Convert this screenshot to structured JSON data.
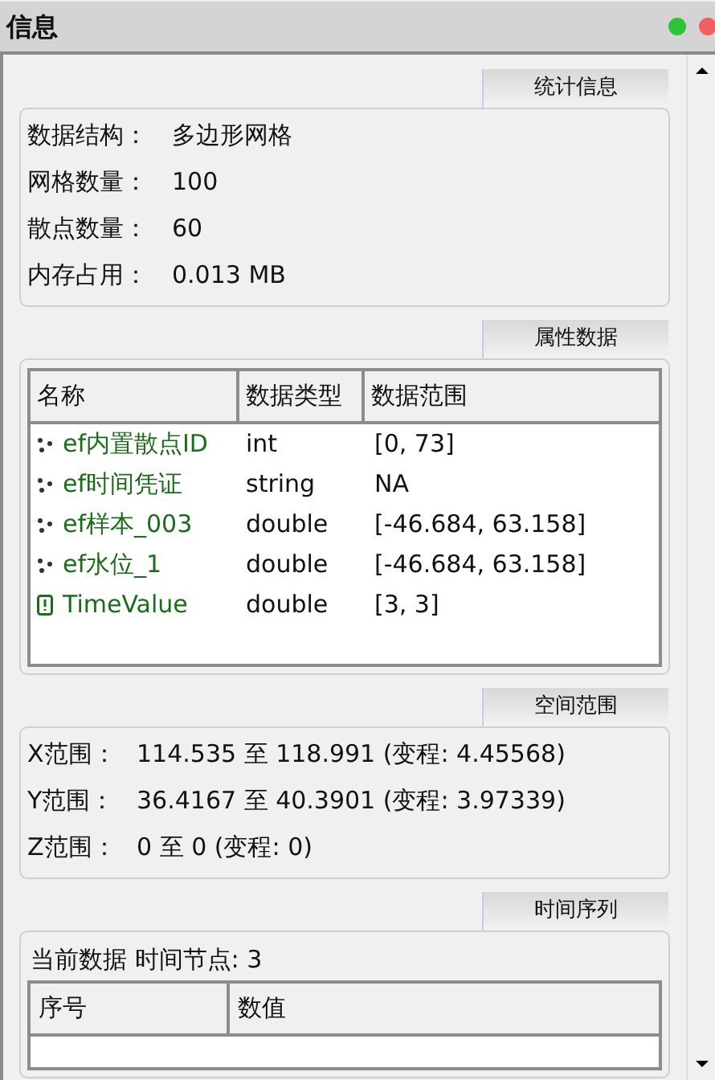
{
  "window": {
    "title": "信息"
  },
  "stats": {
    "tab": "统计信息",
    "rows": [
      {
        "label": "数据结构：",
        "value": "多边形网格"
      },
      {
        "label": "网格数量：",
        "value": "100"
      },
      {
        "label": "散点数量：",
        "value": "60"
      },
      {
        "label": "内存占用：",
        "value": "0.013 MB"
      }
    ]
  },
  "attributes": {
    "tab": "属性数据",
    "columns": [
      "名称",
      "数据类型",
      "数据范围"
    ],
    "rows": [
      {
        "kind": "scatter",
        "name": "ef内置散点ID",
        "type": "int",
        "range": "[0, 73]"
      },
      {
        "kind": "scatter",
        "name": "ef时间凭证",
        "type": "string",
        "range": "NA"
      },
      {
        "kind": "scatter",
        "name": "ef样本_003",
        "type": "double",
        "range": "[-46.684, 63.158]"
      },
      {
        "kind": "scatter",
        "name": "ef水位_1",
        "type": "double",
        "range": "[-46.684, 63.158]"
      },
      {
        "kind": "time",
        "name": "TimeValue",
        "type": "double",
        "range": "[3, 3]"
      }
    ]
  },
  "extent": {
    "tab": "空间范围",
    "rows": [
      {
        "label": "X范围：",
        "value": "114.535 至 118.991 (变程: 4.45568)"
      },
      {
        "label": "Y范围：",
        "value": "36.4167 至 40.3901 (变程: 3.97339)"
      },
      {
        "label": "Z范围：",
        "value": "0 至 0 (变程: 0)"
      }
    ]
  },
  "time_series": {
    "tab": "时间序列",
    "summary": "当前数据 时间节点: 3",
    "columns": [
      "序号",
      "数值"
    ]
  }
}
